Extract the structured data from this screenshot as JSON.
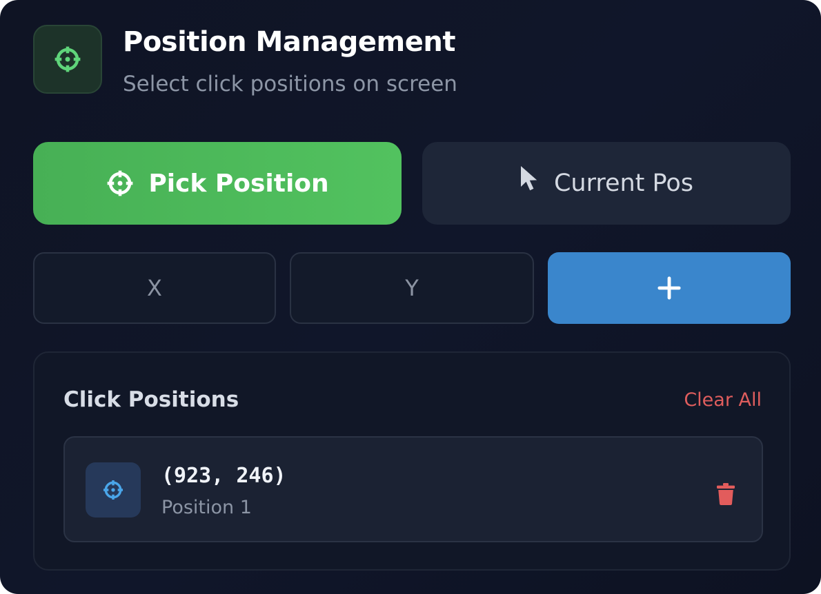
{
  "header": {
    "title": "Position Management",
    "subtitle": "Select click positions on screen",
    "icon": "crosshair-icon"
  },
  "actions": {
    "pick_label": "Pick Position",
    "pick_icon": "crosshair-icon",
    "current_label": "Current Pos",
    "current_icon": "mouse-pointer-icon"
  },
  "manual_entry": {
    "x_placeholder": "X",
    "y_placeholder": "Y",
    "add_icon": "plus-icon"
  },
  "positions": {
    "title": "Click Positions",
    "clear_label": "Clear All",
    "items": [
      {
        "coords": "(923, 246)",
        "label": "Position 1",
        "icon": "crosshair-icon",
        "delete_icon": "trash-icon"
      }
    ]
  },
  "colors": {
    "accent_green": "#52c25f",
    "accent_blue": "#3a86cc",
    "danger_red": "#df5d5d",
    "background": "#10162a"
  }
}
